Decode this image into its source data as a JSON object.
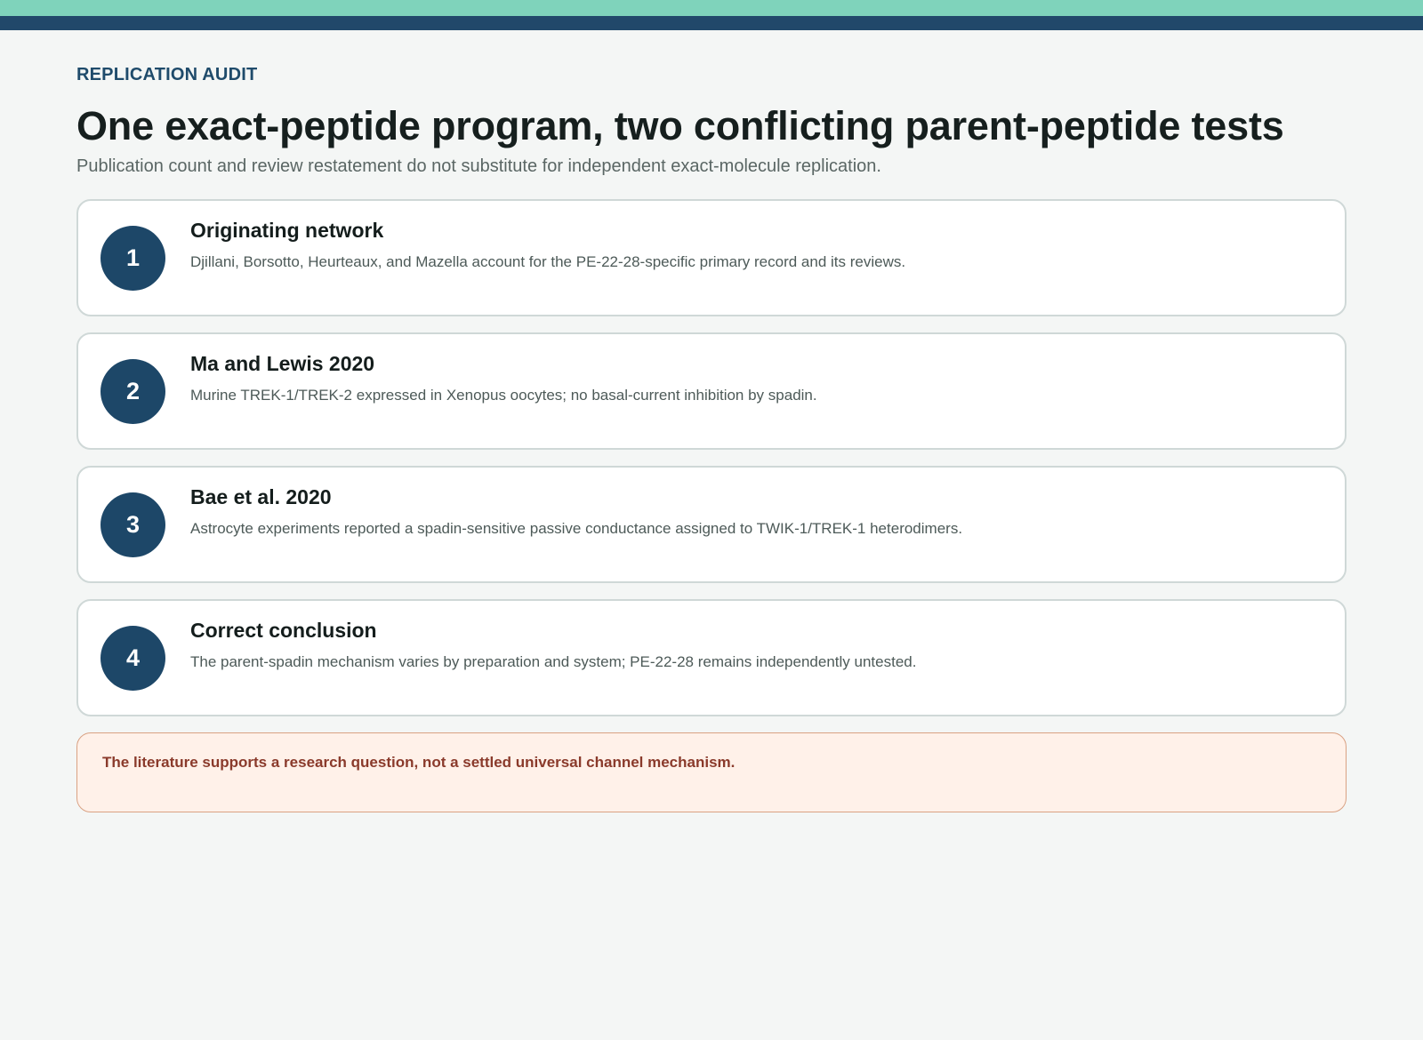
{
  "header": {
    "eyebrow": "REPLICATION AUDIT",
    "title": "One exact-peptide program, two conflicting parent-peptide tests",
    "subtitle": "Publication count and review restatement do not substitute for independent exact-molecule replication."
  },
  "cards": [
    {
      "number": "1",
      "title": "Originating network",
      "text": "Djillani, Borsotto, Heurteaux, and Mazella account for the PE-22-28-specific primary record and its reviews."
    },
    {
      "number": "2",
      "title": "Ma and Lewis 2020",
      "text": "Murine TREK-1/TREK-2 expressed in Xenopus oocytes; no basal-current inhibition by spadin."
    },
    {
      "number": "3",
      "title": "Bae et al. 2020",
      "text": "Astrocyte experiments reported a spadin-sensitive passive conductance assigned to TWIK-1/TREK-1 heterodimers."
    },
    {
      "number": "4",
      "title": "Correct conclusion",
      "text": "The parent-spadin mechanism varies by preparation and system; PE-22-28 remains independently untested."
    }
  ],
  "callout": {
    "text": "The literature supports a research question, not a settled universal channel mechanism."
  },
  "colors": {
    "accent_top": "#7fd3bb",
    "accent_navy": "#21486a",
    "badge": "#1d4768",
    "callout_bg": "#fff1e9",
    "callout_text": "#8a3a2b"
  }
}
